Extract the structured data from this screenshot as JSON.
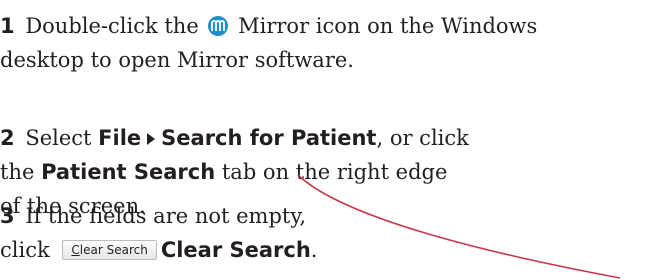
{
  "steps": [
    {
      "num": "1",
      "lines": [
        {
          "pre": "Double-click the",
          "post": "Mirror icon on the Windows"
        },
        {
          "text": "desktop to open Mirror software."
        }
      ],
      "icon": "mirror-app-icon"
    },
    {
      "num": "2",
      "lines": [
        {
          "pre": "Select",
          "menu1": "File",
          "menu2": "Search for Patient",
          "post": ", or click"
        },
        {
          "pre": "the",
          "ui": "Patient Search",
          "post": "tab on the right edge"
        },
        {
          "text": "of the screen."
        }
      ]
    },
    {
      "num": "3",
      "lines": [
        {
          "text": "If the fields are not empty,"
        },
        {
          "pre": "click",
          "button": "Clear Search",
          "ui": "Clear Search",
          "post": "."
        }
      ]
    }
  ],
  "colors": {
    "callout_line": "#c8384a",
    "mirror_icon": "#1e8fc9",
    "text": "#231f20"
  }
}
